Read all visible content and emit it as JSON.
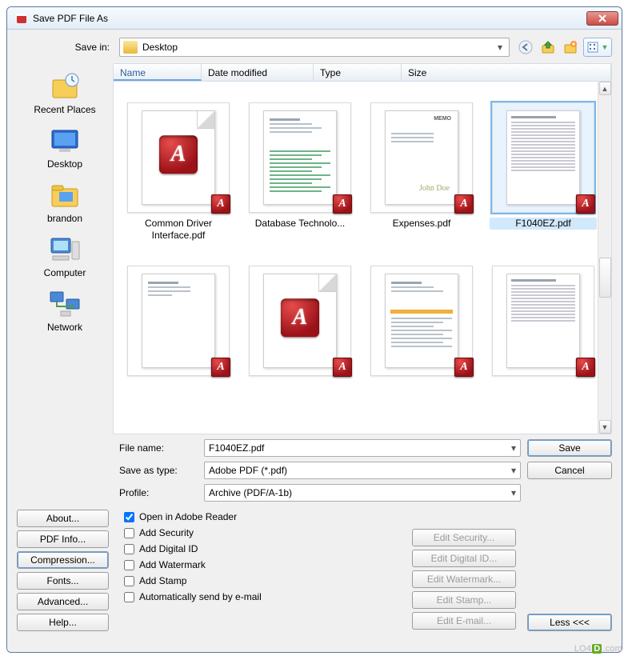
{
  "window": {
    "title": "Save PDF File As"
  },
  "toolbar": {
    "save_in_label": "Save in:",
    "location": "Desktop",
    "nav": {
      "back": "back-icon",
      "up": "up-one-level-icon",
      "new_folder": "new-folder-icon",
      "view_menu": "view-menu-icon"
    }
  },
  "columns": [
    "Name",
    "Date modified",
    "Type",
    "Size"
  ],
  "places": [
    {
      "label": "Recent Places"
    },
    {
      "label": "Desktop"
    },
    {
      "label": "brandon"
    },
    {
      "label": "Computer"
    },
    {
      "label": "Network"
    }
  ],
  "files": {
    "row0": [
      {
        "name": "Common Driver Interface.pdf",
        "kind": "adobe-big"
      },
      {
        "name": "Database Technolo...",
        "kind": "text-green"
      },
      {
        "name": "Expenses.pdf",
        "kind": "memo"
      },
      {
        "name": "F1040EZ.pdf",
        "kind": "form",
        "selected": true
      }
    ],
    "row1": [
      {
        "name": "",
        "kind": "text-plain"
      },
      {
        "name": "",
        "kind": "adobe-big"
      },
      {
        "name": "",
        "kind": "orange"
      },
      {
        "name": "",
        "kind": "form2"
      }
    ]
  },
  "fields": {
    "file_name_label": "File name:",
    "file_name_value": "F1040EZ.pdf",
    "save_type_label": "Save as type:",
    "save_type_value": "Adobe PDF (*.pdf)",
    "profile_label": "Profile:",
    "profile_value": "Archive (PDF/A-1b)"
  },
  "actions": {
    "save": "Save",
    "cancel": "Cancel",
    "less": "Less <<<"
  },
  "option_buttons": {
    "about": "About...",
    "pdf_info": "PDF Info...",
    "compression": "Compression...",
    "fonts": "Fonts...",
    "advanced": "Advanced...",
    "help": "Help..."
  },
  "checkboxes": {
    "open_reader": {
      "label": "Open in Adobe Reader",
      "checked": true
    },
    "add_security": {
      "label": "Add Security",
      "checked": false
    },
    "add_digital": {
      "label": "Add Digital ID",
      "checked": false
    },
    "add_watermark": {
      "label": "Add Watermark",
      "checked": false
    },
    "add_stamp": {
      "label": "Add Stamp",
      "checked": false
    },
    "auto_email": {
      "label": "Automatically send by e-mail",
      "checked": false
    }
  },
  "edit_buttons": {
    "security": "Edit Security...",
    "digital": "Edit Digital ID...",
    "watermark": "Edit Watermark...",
    "stamp": "Edit Stamp...",
    "email": "Edit E-mail..."
  },
  "watermark_text": "LO4D.com"
}
